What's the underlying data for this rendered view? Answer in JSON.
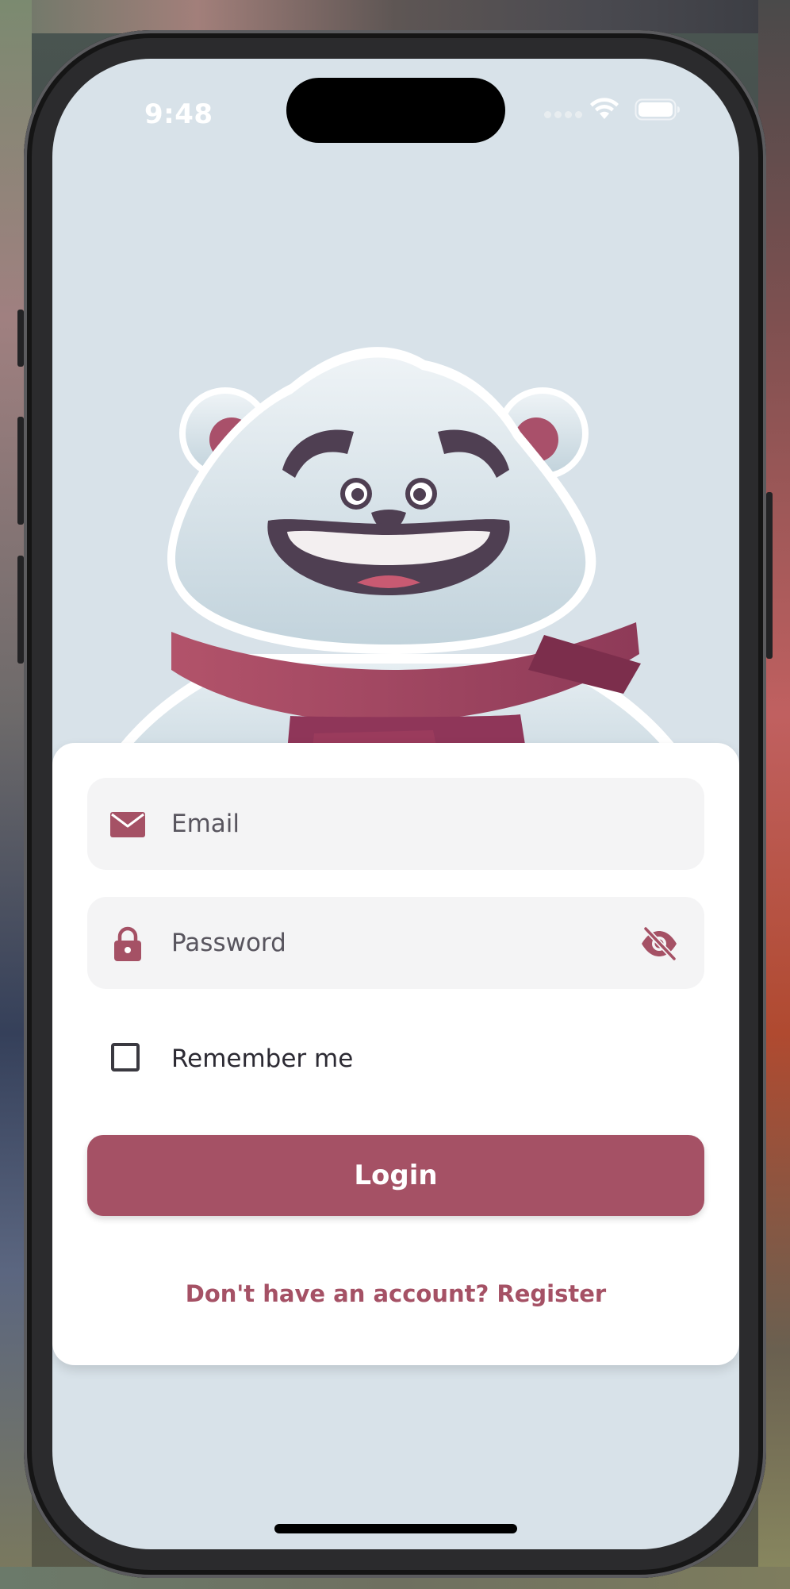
{
  "status_bar": {
    "time": "9:48",
    "icons": [
      "cellular-signal-icon",
      "wifi-icon",
      "battery-icon"
    ]
  },
  "hero": {
    "image": "polar-bear-mascot-with-scarf"
  },
  "form": {
    "email": {
      "placeholder": "Email",
      "value": "",
      "icon": "envelope-icon"
    },
    "password": {
      "placeholder": "Password",
      "value": "",
      "icon": "lock-icon",
      "toggle_icon": "eye-slash-icon"
    },
    "remember": {
      "label": "Remember me",
      "checked": false
    },
    "login_label": "Login",
    "register_link": "Don't have an account? Register"
  },
  "colors": {
    "accent": "#a55165",
    "screen_background": "#d8e2e9",
    "field_background": "#f4f4f5",
    "card_background": "#ffffff"
  }
}
